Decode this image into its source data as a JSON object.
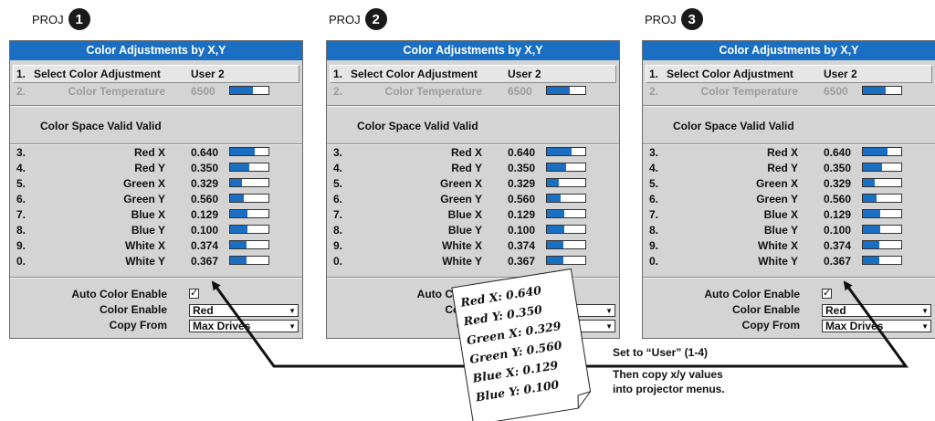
{
  "projectors": [
    {
      "label": "PROJ",
      "number": "1",
      "title": "Color Adjustments by X,Y",
      "select": {
        "num": "1.",
        "label": "Select Color Adjustment",
        "value": "User 2"
      },
      "temp": {
        "num": "2.",
        "label": "Color Temperature",
        "value": "6500",
        "level": 0.6
      },
      "valid_text": "Color Space Valid Valid",
      "rows": [
        {
          "num": "3.",
          "label": "Red X",
          "value": "0.640",
          "level": 0.64
        },
        {
          "num": "4.",
          "label": "Red Y",
          "value": "0.350",
          "level": 0.5
        },
        {
          "num": "5.",
          "label": "Green X",
          "value": "0.329",
          "level": 0.3
        },
        {
          "num": "6.",
          "label": "Green Y",
          "value": "0.560",
          "level": 0.36
        },
        {
          "num": "7.",
          "label": "Blue X",
          "value": "0.129",
          "level": 0.45
        },
        {
          "num": "8.",
          "label": "Blue Y",
          "value": "0.100",
          "level": 0.46
        },
        {
          "num": "9.",
          "label": "White X",
          "value": "0.374",
          "level": 0.44
        },
        {
          "num": "0.",
          "label": "White Y",
          "value": "0.367",
          "level": 0.44
        }
      ],
      "auto_label": "Auto Color Enable",
      "auto_check": "✓",
      "enable_label": "Color Enable",
      "enable_value": "Red",
      "copy_label": "Copy From",
      "copy_value": "Max Drives"
    },
    {
      "label": "PROJ",
      "number": "2",
      "title": "Color Adjustments by X,Y",
      "select": {
        "num": "1.",
        "label": "Select Color Adjustment",
        "value": "User 2"
      },
      "temp": {
        "num": "2.",
        "label": "Color Temperature",
        "value": "6500",
        "level": 0.6
      },
      "valid_text": "Color Space Valid Valid",
      "rows": [
        {
          "num": "3.",
          "label": "Red X",
          "value": "0.640",
          "level": 0.64
        },
        {
          "num": "4.",
          "label": "Red Y",
          "value": "0.350",
          "level": 0.5
        },
        {
          "num": "5.",
          "label": "Green X",
          "value": "0.329",
          "level": 0.3
        },
        {
          "num": "6.",
          "label": "Green Y",
          "value": "0.560",
          "level": 0.36
        },
        {
          "num": "7.",
          "label": "Blue X",
          "value": "0.129",
          "level": 0.45
        },
        {
          "num": "8.",
          "label": "Blue Y",
          "value": "0.100",
          "level": 0.46
        },
        {
          "num": "9.",
          "label": "White X",
          "value": "0.374",
          "level": 0.44
        },
        {
          "num": "0.",
          "label": "White Y",
          "value": "0.367",
          "level": 0.44
        }
      ],
      "auto_label": "Auto Color E",
      "auto_check": "",
      "enable_label": "Color E",
      "enable_value": "",
      "copy_label": "Copy",
      "copy_value": ""
    },
    {
      "label": "PROJ",
      "number": "3",
      "title": "Color Adjustments by X,Y",
      "select": {
        "num": "1.",
        "label": "Select Color Adjustment",
        "value": "User 2"
      },
      "temp": {
        "num": "2.",
        "label": "Color Temperature",
        "value": "6500",
        "level": 0.6
      },
      "valid_text": "Color Space Valid Valid",
      "rows": [
        {
          "num": "3.",
          "label": "Red X",
          "value": "0.640",
          "level": 0.64
        },
        {
          "num": "4.",
          "label": "Red Y",
          "value": "0.350",
          "level": 0.5
        },
        {
          "num": "5.",
          "label": "Green X",
          "value": "0.329",
          "level": 0.3
        },
        {
          "num": "6.",
          "label": "Green Y",
          "value": "0.560",
          "level": 0.36
        },
        {
          "num": "7.",
          "label": "Blue X",
          "value": "0.129",
          "level": 0.45
        },
        {
          "num": "8.",
          "label": "Blue Y",
          "value": "0.100",
          "level": 0.46
        },
        {
          "num": "9.",
          "label": "White X",
          "value": "0.374",
          "level": 0.44
        },
        {
          "num": "0.",
          "label": "White Y",
          "value": "0.367",
          "level": 0.44
        }
      ],
      "auto_label": "Auto Color Enable",
      "auto_check": "✓",
      "enable_label": "Color Enable",
      "enable_value": "Red",
      "copy_label": "Copy From",
      "copy_value": "Max Drives"
    }
  ],
  "note": {
    "line1": "Set to “User” (1-4)",
    "line2": "Then copy x/y values",
    "line3": "into projector menus."
  },
  "paper_lines": [
    "Red X: 0.640",
    "Red Y: 0.350",
    "Green X: 0.329",
    "Green Y: 0.560",
    "Blue X: 0.129",
    "Blue Y: 0.100"
  ],
  "colors": {
    "title_bar": "#1a6fc2",
    "panel_bg": "#d4d4d4",
    "bar_fill": "#1a6fc2"
  }
}
